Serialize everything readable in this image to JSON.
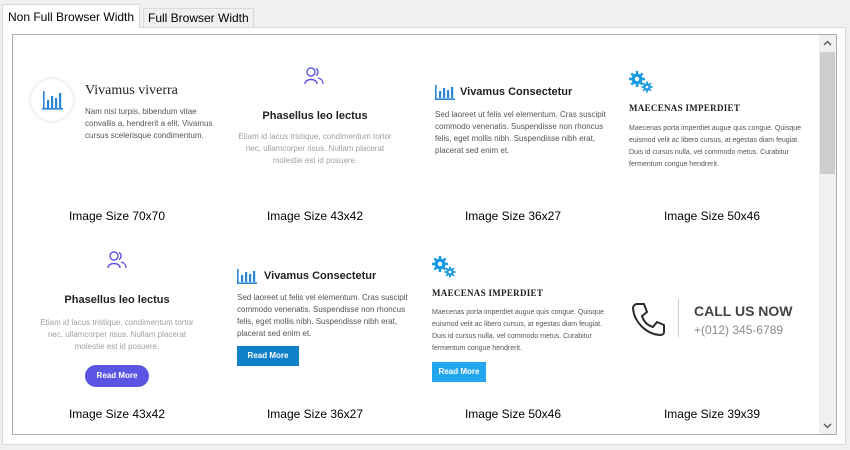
{
  "tabs": [
    {
      "label": "Non Full Browser Width"
    },
    {
      "label": "Full Browser Width"
    }
  ],
  "scrollbar": {
    "up_icon": "chevron-up-icon",
    "down_icon": "chevron-down-icon",
    "position": 0.0
  },
  "row1": [
    {
      "title": "Vivamus viverra",
      "body": "Nam nisl turpis, bibendum vitae convallis a, hendrerit a elit. Vivamus cursus scelerisque condimentum.",
      "caption": "Image Size 70x70",
      "icon": "bar-chart-icon"
    },
    {
      "title": "Phasellus leo lectus",
      "body": "Etiam id lacus tristique, condimentum tortor nec, ullamcorper risus. Nullam placerat molestie est id posuere.",
      "caption": "Image Size 43x42",
      "icon": "users-icon"
    },
    {
      "title": "Vivamus Consectetur",
      "body": "Sed laoreet ut felis vel elementum. Cras suscipit commodo venenatis. Suspendisse non rhoncus felis, eget mollis nibh. Suspendisse nibh erat, placerat sed enim et.",
      "caption": "Image Size 36x27",
      "icon": "bar-chart-icon"
    },
    {
      "title": "MAECENAS IMPERDIET",
      "body": "Maecenas porta imperdiet augue quis congue. Quisque euismod velit ac libero cursus, at egestas diam feugiat. Duis id cursus nulla, vel commodo metus. Curabitur fermentum congue hendrerit.",
      "caption": "Image Size 50x46",
      "icon": "gears-icon"
    }
  ],
  "row2": [
    {
      "title": "Phasellus leo lectus",
      "body": "Etiam id lacus tristique, condimentum tortor nec, ullamcorper risus. Nullam placerat molestie est id posuere.",
      "button": "Read More",
      "caption": "Image Size 43x42",
      "icon": "users-icon"
    },
    {
      "title": "Vivamus Consectetur",
      "body": "Sed laoreet ut felis vel elementum. Cras suscipit commodo venenatis. Suspendisse non rhoncus felis, eget mollis nibh. Suspendisse nibh erat, placerat sed enim et.",
      "button": "Read More",
      "caption": "Image Size 36x27",
      "icon": "bar-chart-icon"
    },
    {
      "title": "MAECENAS IMPERDIET",
      "body": "Maecenas porta imperdiet augue quis congue. Quisque euismod velit ac libero cursus, at egestas diam feugiat. Duis id cursus nulla, vel commodo metus. Curabitur fermentum congue hendrerit.",
      "button": "Read More",
      "caption": "Image Size 50x46",
      "icon": "gears-icon"
    },
    {
      "title": "CALL US NOW",
      "phone": "+(012) 345-6789",
      "caption": "Image Size 39x39",
      "icon": "phone-icon"
    }
  ],
  "colors": {
    "accent_blue": "#2a86d4",
    "purple": "#5b55e4",
    "button_blue": "#0f7fc9",
    "light_blue": "#22a6ee",
    "gear_blue": "#1a9ae0"
  }
}
